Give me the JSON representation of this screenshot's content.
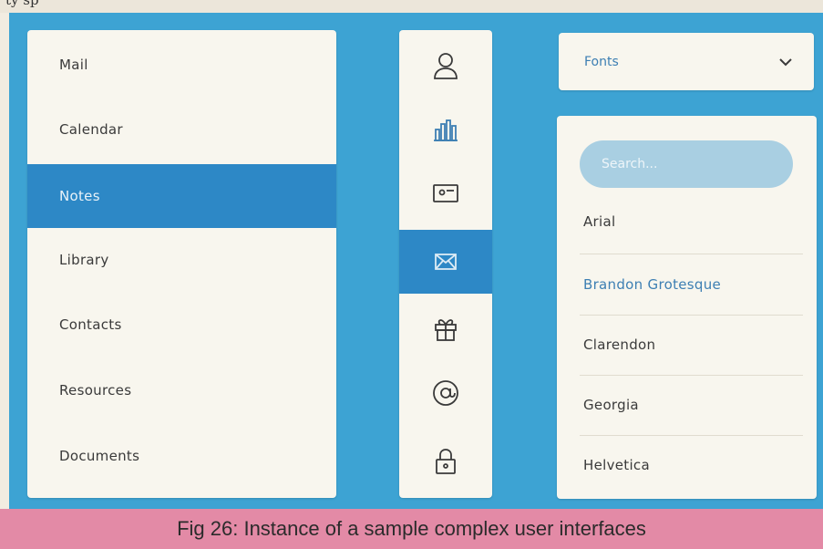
{
  "top_text": "ty sp",
  "menu": {
    "items": [
      {
        "label": "Mail"
      },
      {
        "label": "Calendar"
      },
      {
        "label": "Notes"
      },
      {
        "label": "Library"
      },
      {
        "label": "Contacts"
      },
      {
        "label": "Resources"
      },
      {
        "label": "Documents"
      }
    ],
    "active": "Notes"
  },
  "iconbar": {
    "icons": [
      "user-icon",
      "bar-chart-icon",
      "card-icon",
      "mail-icon",
      "gift-icon",
      "at-sign-icon",
      "lock-icon"
    ],
    "active": "mail-icon"
  },
  "fonts_dropdown": {
    "label": "Fonts"
  },
  "font_list": {
    "search_placeholder": "Search...",
    "items": [
      {
        "label": "Arial"
      },
      {
        "label": "Brandon Grotesque"
      },
      {
        "label": "Clarendon"
      },
      {
        "label": "Georgia"
      },
      {
        "label": "Helvetica"
      }
    ],
    "highlighted": "Brandon Grotesque"
  },
  "caption": "Fig 26: Instance of a sample complex user interfaces",
  "colors": {
    "panel_blue": "#3da3d3",
    "active_blue": "#2d88c6",
    "card": "#f8f6ee",
    "caption_pink": "#e38aa6",
    "search_pill": "#a9cfe2"
  }
}
